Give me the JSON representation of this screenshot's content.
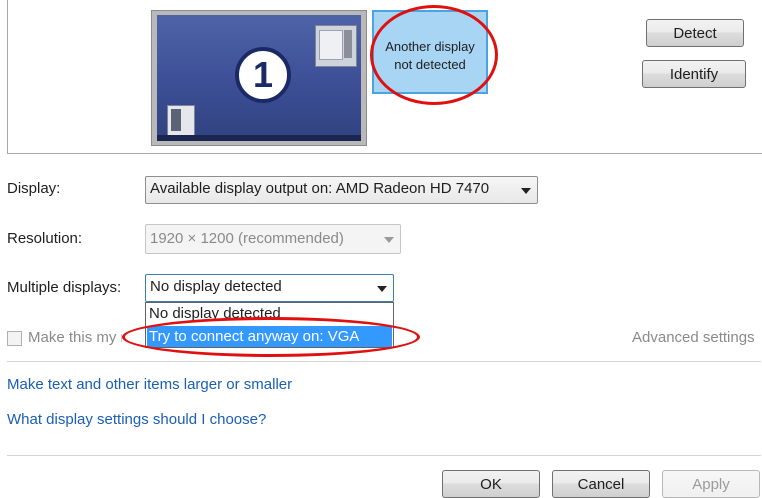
{
  "preview": {
    "monitor1_number": "1",
    "monitor2_text": "Another display\nnot detected"
  },
  "buttons": {
    "detect": "Detect",
    "identify": "Identify",
    "ok": "OK",
    "cancel": "Cancel",
    "apply": "Apply"
  },
  "settings": {
    "display_label": "Display:",
    "display_value": "Available display output on: AMD Radeon HD 7470",
    "resolution_label": "Resolution:",
    "resolution_value": "1920 × 1200 (recommended)",
    "multiple_label": "Multiple displays:",
    "multiple_value": "No display detected",
    "multiple_options": [
      "No display detected",
      "Try to connect anyway on: VGA"
    ],
    "make_main_label": "Make this my main display",
    "advanced_settings": "Advanced settings"
  },
  "links": {
    "larger_text": "Make text and other items larger or smaller",
    "which_settings": "What display settings should I choose?"
  },
  "colors": {
    "annotation": "#e01010",
    "selection": "#3399ff",
    "link": "#1a5fb4"
  }
}
